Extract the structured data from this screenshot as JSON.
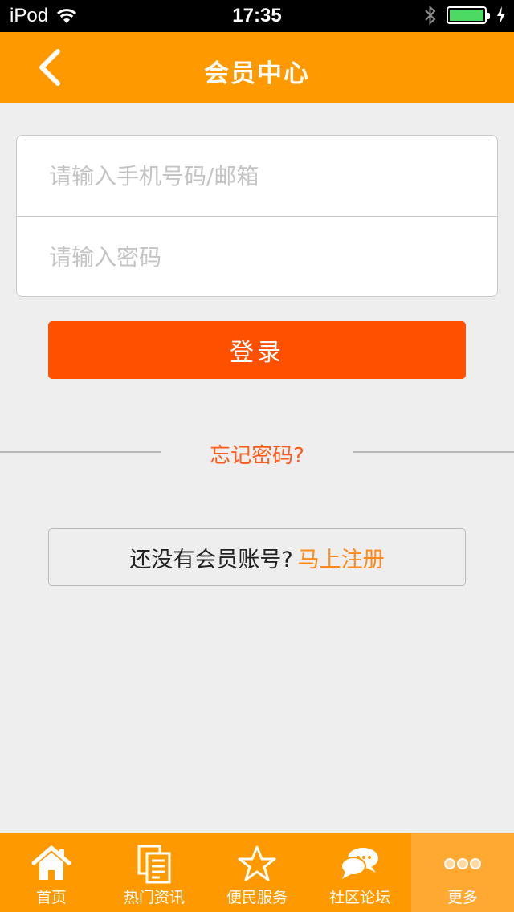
{
  "status_bar": {
    "carrier": "iPod",
    "time": "17:35"
  },
  "nav": {
    "title": "会员中心",
    "back_icon": "chevron-left-icon"
  },
  "login_form": {
    "account_placeholder": "请输入手机号码/邮箱",
    "account_value": "",
    "password_placeholder": "请输入密码",
    "password_value": "",
    "submit_label": "登录"
  },
  "forgot_password": "忘记密码?",
  "register": {
    "prompt": "还没有会员账号?",
    "link": "马上注册"
  },
  "tab_bar": {
    "items": [
      {
        "label": "首页",
        "icon": "home-icon"
      },
      {
        "label": "热门资讯",
        "icon": "documents-icon"
      },
      {
        "label": "便民服务",
        "icon": "star-icon"
      },
      {
        "label": "社区论坛",
        "icon": "chat-bubbles-icon"
      },
      {
        "label": "更多",
        "icon": "more-dots-icon"
      }
    ],
    "active_index": 4
  },
  "colors": {
    "brand_orange": "#ff9900",
    "login_button": "#ff5000",
    "forgot_link": "#ff5a1a",
    "register_link": "#ff8a1a"
  }
}
